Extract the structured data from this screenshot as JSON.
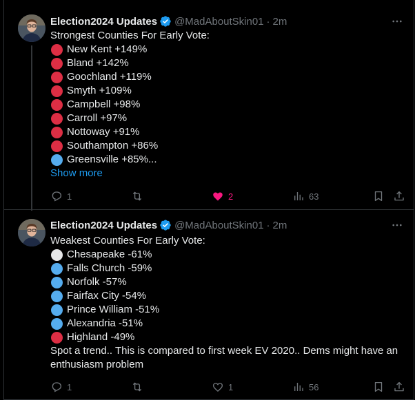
{
  "colors": {
    "red": "#dd2e44",
    "blue": "#55acee",
    "white": "#e6e7e8",
    "link": "#1d9bf0",
    "like": "#f91880",
    "verified": "#1d9bf0"
  },
  "tweets": [
    {
      "author": {
        "name": "Election2024 Updates",
        "handle": "@MadAboutSkin01",
        "time": "2m"
      },
      "intro": "Strongest Counties For Early Vote:",
      "items": [
        {
          "text": "New Kent +149%",
          "circle": "red"
        },
        {
          "text": "Bland +142%",
          "circle": "red"
        },
        {
          "text": "Goochland +119%",
          "circle": "red"
        },
        {
          "text": "Smyth +109%",
          "circle": "red"
        },
        {
          "text": "Campbell +98%",
          "circle": "red"
        },
        {
          "text": "Carroll +97%",
          "circle": "red"
        },
        {
          "text": "Nottoway +91%",
          "circle": "red"
        },
        {
          "text": "Southampton +86%",
          "circle": "red"
        },
        {
          "text": "Greensville +85%...",
          "circle": "blue"
        }
      ],
      "show_more": "Show more",
      "stats": {
        "replies": "1",
        "reposts": "",
        "likes": "2",
        "views": "63"
      }
    },
    {
      "author": {
        "name": "Election2024 Updates",
        "handle": "@MadAboutSkin01",
        "time": "2m"
      },
      "intro": "Weakest Counties For Early Vote:",
      "items": [
        {
          "text": "Chesapeake -61%",
          "circle": "white"
        },
        {
          "text": "Falls Church -59%",
          "circle": "blue"
        },
        {
          "text": "Norfolk -57%",
          "circle": "blue"
        },
        {
          "text": "Fairfax City -54%",
          "circle": "blue"
        },
        {
          "text": "Prince William -51%",
          "circle": "blue"
        },
        {
          "text": "Alexandria -51%",
          "circle": "blue"
        },
        {
          "text": "Highland -49%",
          "circle": "red"
        }
      ],
      "outro": "Spot a trend.. This is compared to first week EV 2020.. Dems might have an enthusiasm problem",
      "stats": {
        "replies": "1",
        "reposts": "",
        "likes": "1",
        "views": "56"
      }
    }
  ],
  "icons": {
    "reply": "reply-icon",
    "repost": "repost-icon",
    "like": "heart-icon",
    "views": "views-icon",
    "bookmark": "bookmark-icon",
    "share": "share-icon",
    "more": "more-icon",
    "verified": "verified-badge-icon"
  }
}
